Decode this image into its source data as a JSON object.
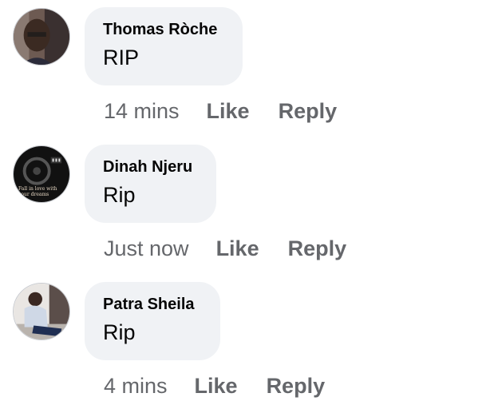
{
  "comments": [
    {
      "author": "Thomas Ròche",
      "text": "RIP",
      "time": "14 mins",
      "like_label": "Like",
      "reply_label": "Reply"
    },
    {
      "author": "Dinah Njeru",
      "text": "Rip",
      "time": "Just now",
      "like_label": "Like",
      "reply_label": "Reply",
      "avatar_caption": "Fall in love with your dreams"
    },
    {
      "author": "Patra Sheila",
      "text": "Rip",
      "time": "4 mins",
      "like_label": "Like",
      "reply_label": "Reply"
    }
  ],
  "colors": {
    "bubble": "#f0f2f5",
    "text": "#050505",
    "secondary": "#65676b"
  }
}
